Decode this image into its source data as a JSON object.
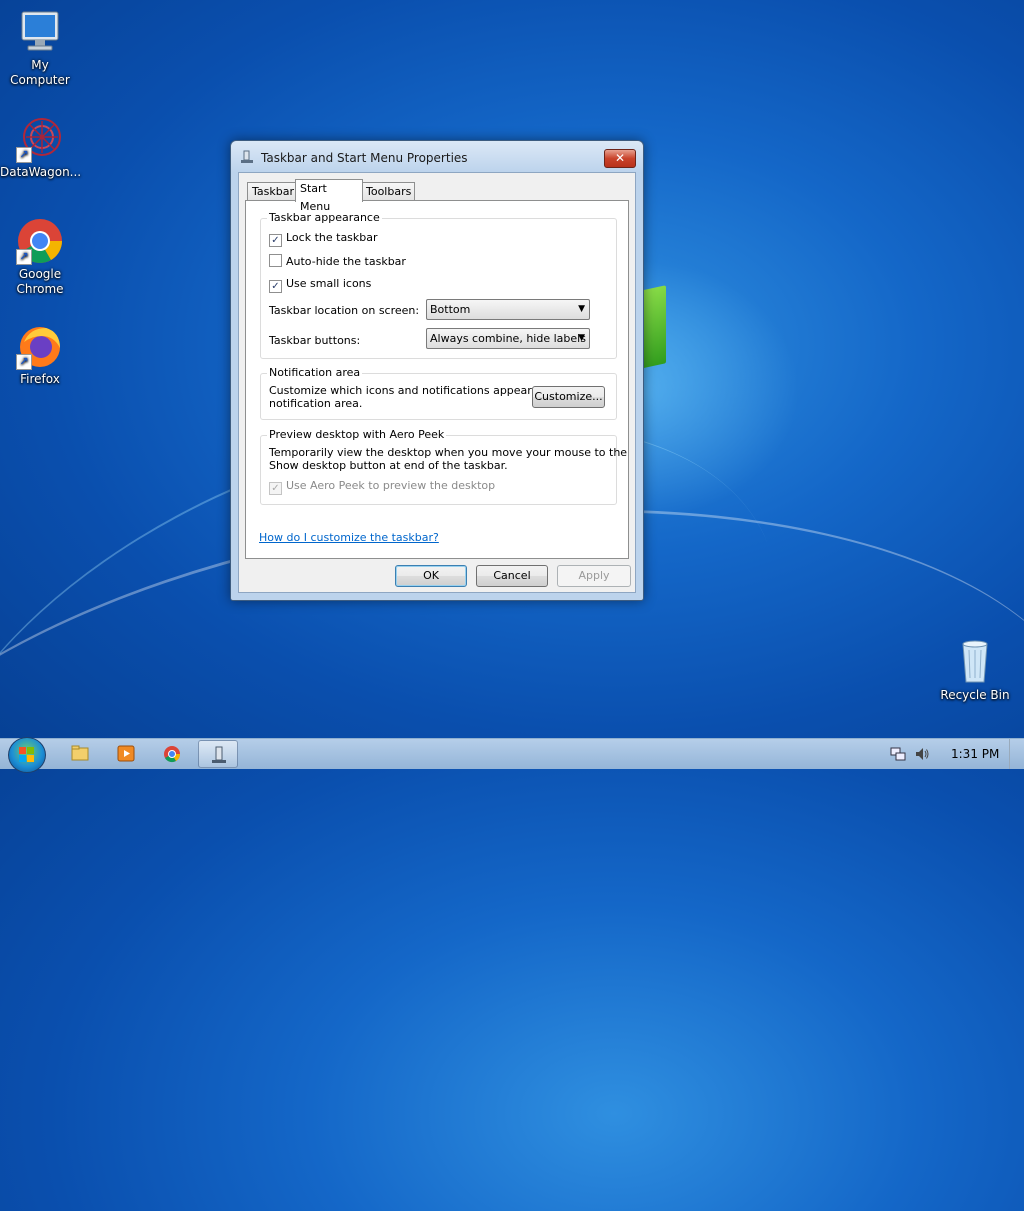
{
  "desktop": {
    "icons": [
      {
        "label": "My Computer",
        "icon": "computer-icon"
      },
      {
        "label": "DataWagon...",
        "icon": "datawagon-icon"
      },
      {
        "label": "Google Chrome",
        "icon": "chrome-icon"
      },
      {
        "label": "Firefox",
        "icon": "firefox-icon"
      },
      {
        "label": "Recycle Bin",
        "icon": "recycle-bin-icon"
      }
    ]
  },
  "dialog": {
    "title": "Taskbar and Start Menu Properties",
    "close_glyph": "✕",
    "tabs": [
      "Taskbar",
      "Start Menu",
      "Toolbars"
    ],
    "active_tab": "Start Menu",
    "appearance": {
      "title": "Taskbar appearance",
      "lock_label": "Lock the taskbar",
      "lock_checked": true,
      "autohide_label": "Auto-hide the taskbar",
      "autohide_checked": false,
      "small_icons_label": "Use small icons",
      "small_icons_checked": true,
      "location_label": "Taskbar location on screen:",
      "location_value": "Bottom",
      "buttons_label": "Taskbar buttons:",
      "buttons_value": "Always combine, hide labels"
    },
    "notification": {
      "title": "Notification area",
      "text_line1": "Customize which icons and notifications appear in the",
      "text_line2": "notification area.",
      "customize_label": "Customize..."
    },
    "aero_peek": {
      "title": "Preview desktop with Aero Peek",
      "text_line1": "Temporarily view the desktop when you move your mouse to the",
      "text_line2": "Show desktop button at end of the taskbar.",
      "checkbox_label": "Use Aero Peek to preview the desktop",
      "checked": true,
      "enabled": false
    },
    "help_link": "How do I customize the taskbar?",
    "ok_label": "OK",
    "cancel_label": "Cancel",
    "apply_label": "Apply"
  },
  "taskbar": {
    "pinned": [
      "explorer-icon",
      "media-player-icon",
      "chrome-icon",
      "taskbar-properties-icon"
    ],
    "clock": "1:31 PM",
    "tray_icons": [
      "network-icon",
      "volume-icon"
    ]
  },
  "colors": {
    "desktop_blue": "#1467c8",
    "link": "#0066cc",
    "close_red": "#c9432b"
  }
}
